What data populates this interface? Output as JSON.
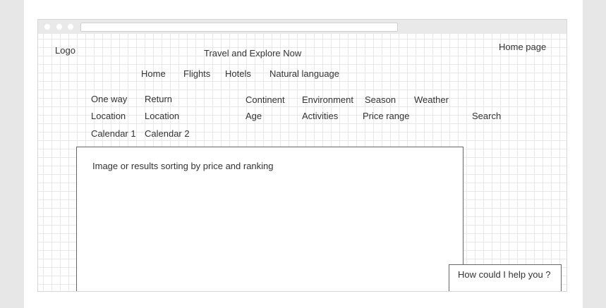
{
  "browser": {
    "window_dots": [
      "close",
      "minimize",
      "maximize"
    ]
  },
  "header": {
    "logo": "Logo",
    "site_title": "Travel and Explore Now",
    "home_page_link": "Home page"
  },
  "nav": {
    "items": [
      "Home",
      "Flights",
      "Hotels",
      "Natural language"
    ]
  },
  "search_form": {
    "trip_type": [
      "One way",
      "Return"
    ],
    "locations": [
      "Location",
      "Location"
    ],
    "calendars": [
      "Calendar 1",
      "Calendar 2"
    ],
    "filters_row1": [
      "Continent",
      "Environment",
      "Season",
      "Weather"
    ],
    "filters_row2": [
      "Age",
      "Activities",
      "Price range"
    ],
    "search_button": "Search"
  },
  "results": {
    "placeholder": "Image or results sorting by price and ranking"
  },
  "chat": {
    "prompt": "How could I help you ?"
  },
  "colors": {
    "page_bg": "#e7e7e7",
    "browser_chrome": "#e9e9e9",
    "grid_line": "#e8e8e8",
    "text": "#333333",
    "box_border": "#666666"
  }
}
